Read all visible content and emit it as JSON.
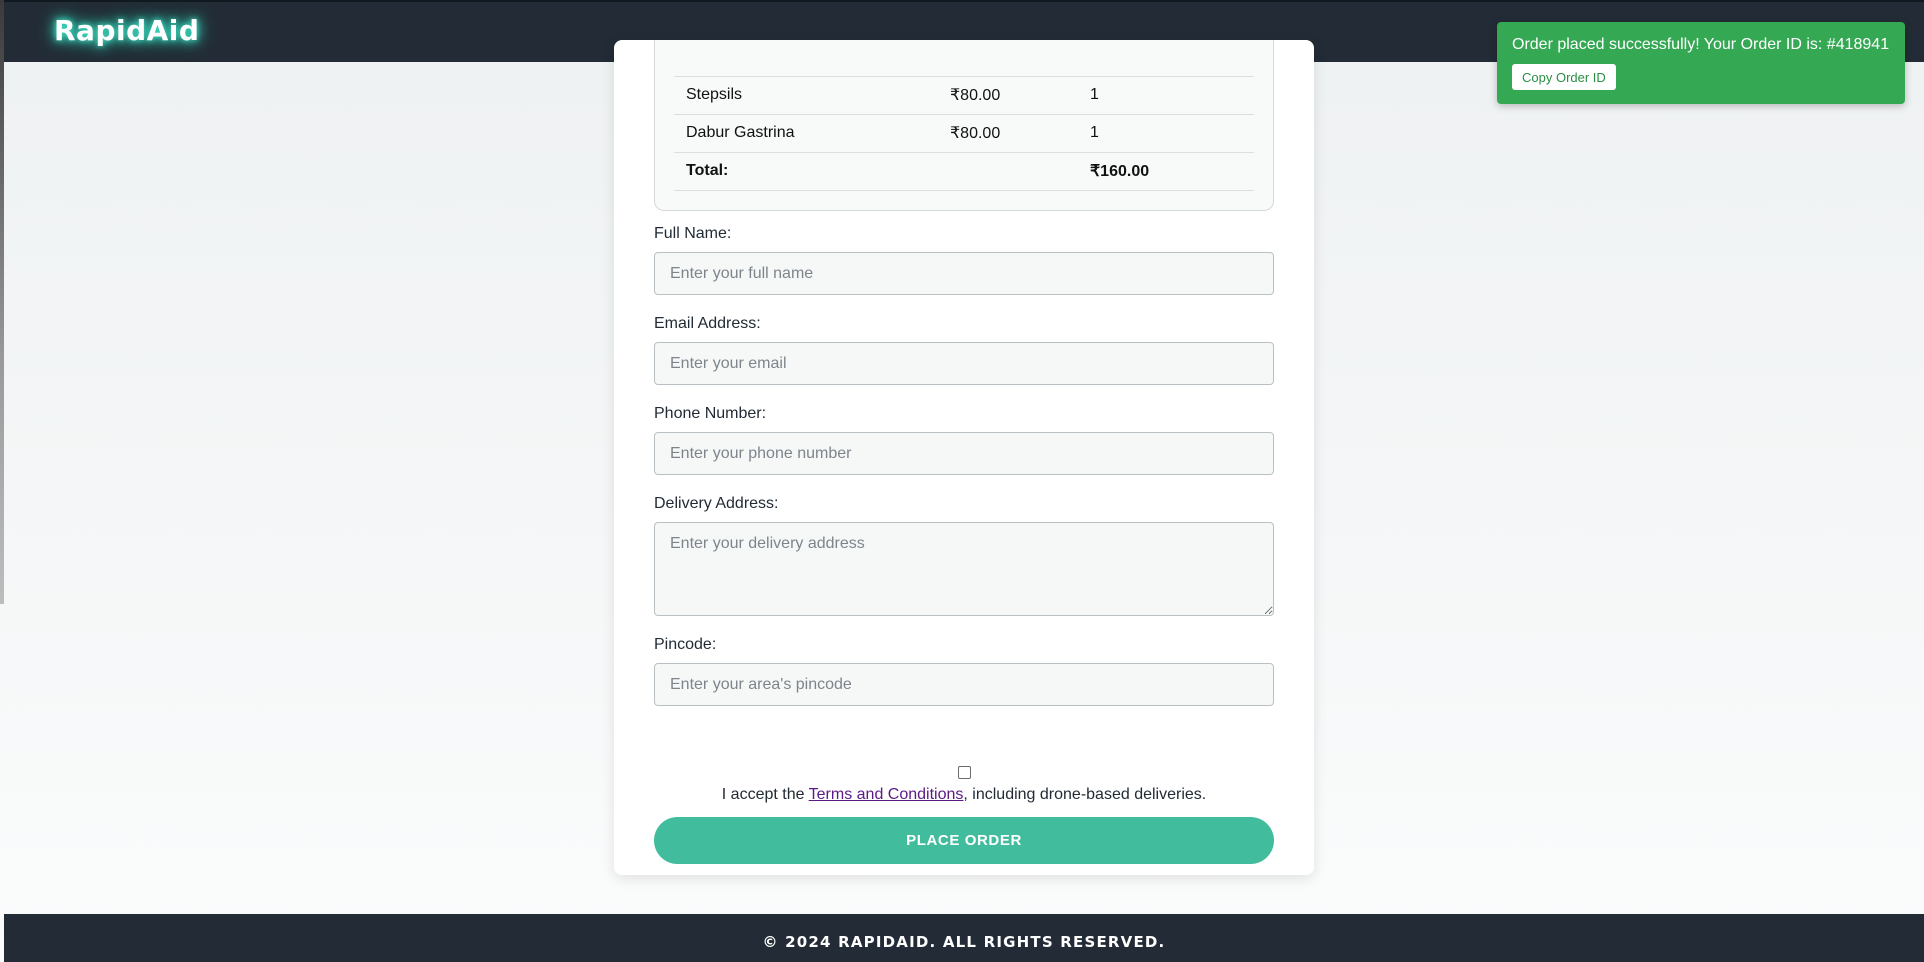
{
  "app": {
    "brand": "RapidAid"
  },
  "order_summary": {
    "items": [
      {
        "name": "Stepsils",
        "price": "₹80.00",
        "quantity": "1"
      },
      {
        "name": "Dabur Gastrina",
        "price": "₹80.00",
        "quantity": "1"
      }
    ],
    "total_label": "Total:",
    "total_value": "₹160.00"
  },
  "form": {
    "full_name": {
      "label": "Full Name:",
      "placeholder": "Enter your full name",
      "value": ""
    },
    "email": {
      "label": "Email Address:",
      "placeholder": "Enter your email",
      "value": ""
    },
    "phone": {
      "label": "Phone Number:",
      "placeholder": "Enter your phone number",
      "value": ""
    },
    "address": {
      "label": "Delivery Address:",
      "placeholder": "Enter your delivery address",
      "value": ""
    },
    "pincode": {
      "label": "Pincode:",
      "placeholder": "Enter your area's pincode",
      "value": ""
    },
    "terms": {
      "checked": false,
      "prefix": "I accept the ",
      "link": "Terms and Conditions",
      "suffix": ", including drone-based deliveries."
    },
    "submit_label": "PLACE ORDER"
  },
  "toast": {
    "message": "Order placed successfully! Your Order ID is: #418941",
    "copy_label": "Copy Order ID",
    "color": "#34a853"
  },
  "footer": {
    "text": "© 2024 RAPIDAID. ALL RIGHTS RESERVED."
  },
  "colors": {
    "navbar": "#232c36",
    "accent": "#41bd9e",
    "toast": "#34a853"
  }
}
